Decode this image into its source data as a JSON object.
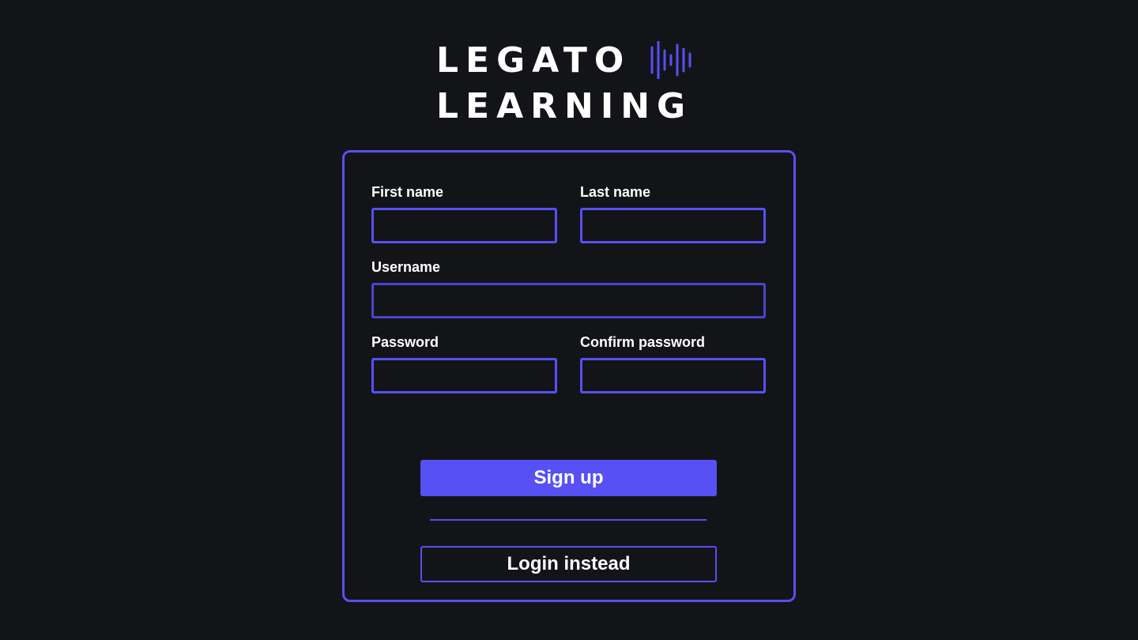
{
  "brand": {
    "line1": "LEGATO",
    "line2": "LEARNING",
    "icon": "sound-wave-icon",
    "accent_color": "#5750f5"
  },
  "form": {
    "first_name": {
      "label": "First name",
      "value": "",
      "placeholder": ""
    },
    "last_name": {
      "label": "Last name",
      "value": "",
      "placeholder": ""
    },
    "username": {
      "label": "Username",
      "value": "",
      "placeholder": ""
    },
    "password": {
      "label": "Password",
      "value": "",
      "placeholder": ""
    },
    "confirm_password": {
      "label": "Confirm password",
      "value": "",
      "placeholder": ""
    }
  },
  "actions": {
    "signup_label": "Sign up",
    "login_label": "Login instead"
  },
  "colors": {
    "background": "#131418",
    "accent": "#5750f5",
    "text": "#ffffff"
  }
}
